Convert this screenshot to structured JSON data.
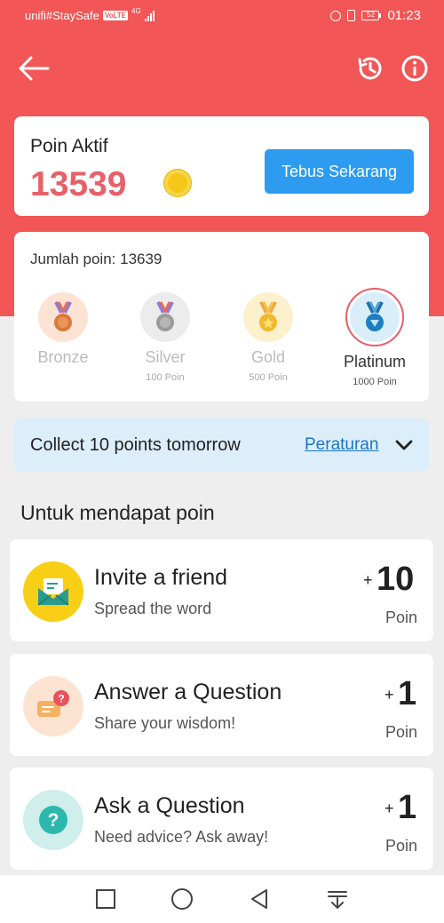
{
  "status_bar": {
    "carrier": "unifi#StaySafe",
    "volte": "VoLTE",
    "network": "4G",
    "battery": "52",
    "time": "01:23"
  },
  "header": {
    "back_icon": "back-arrow-icon",
    "history_icon": "history-icon",
    "info_icon": "info-icon"
  },
  "points_card": {
    "title": "Poin Aktif",
    "value": "13539",
    "redeem_label": "Tebus Sekarang"
  },
  "level_card": {
    "total_label": "Jumlah poin: 13639",
    "tiers": [
      {
        "name": "Bronze",
        "requirement": ""
      },
      {
        "name": "Silver",
        "requirement": "100 Poin"
      },
      {
        "name": "Gold",
        "requirement": "500 Poin"
      },
      {
        "name": "Platinum",
        "requirement": "1000 Poin"
      }
    ],
    "active_tier": "Platinum"
  },
  "collect_bar": {
    "text": "Collect 10 points tomorrow",
    "rules_link": "Peraturan"
  },
  "earn_section": {
    "title": "Untuk mendapat poin",
    "tasks": [
      {
        "title": "Invite a friend",
        "subtitle": "Spread the word",
        "plus": "+",
        "points": "10",
        "unit": "Poin"
      },
      {
        "title": "Answer a Question",
        "subtitle": "Share your wisdom!",
        "plus": "+",
        "points": "1",
        "unit": "Poin"
      },
      {
        "title": "Ask a Question",
        "subtitle": "Need advice? Ask away!",
        "plus": "+",
        "points": "1",
        "unit": "Poin"
      }
    ]
  },
  "colors": {
    "header_red": "#f25656",
    "points_value": "#e7606a",
    "redeem_blue": "#2d9bf0",
    "collect_bg": "#dceefa",
    "link_blue": "#1b75c9"
  }
}
